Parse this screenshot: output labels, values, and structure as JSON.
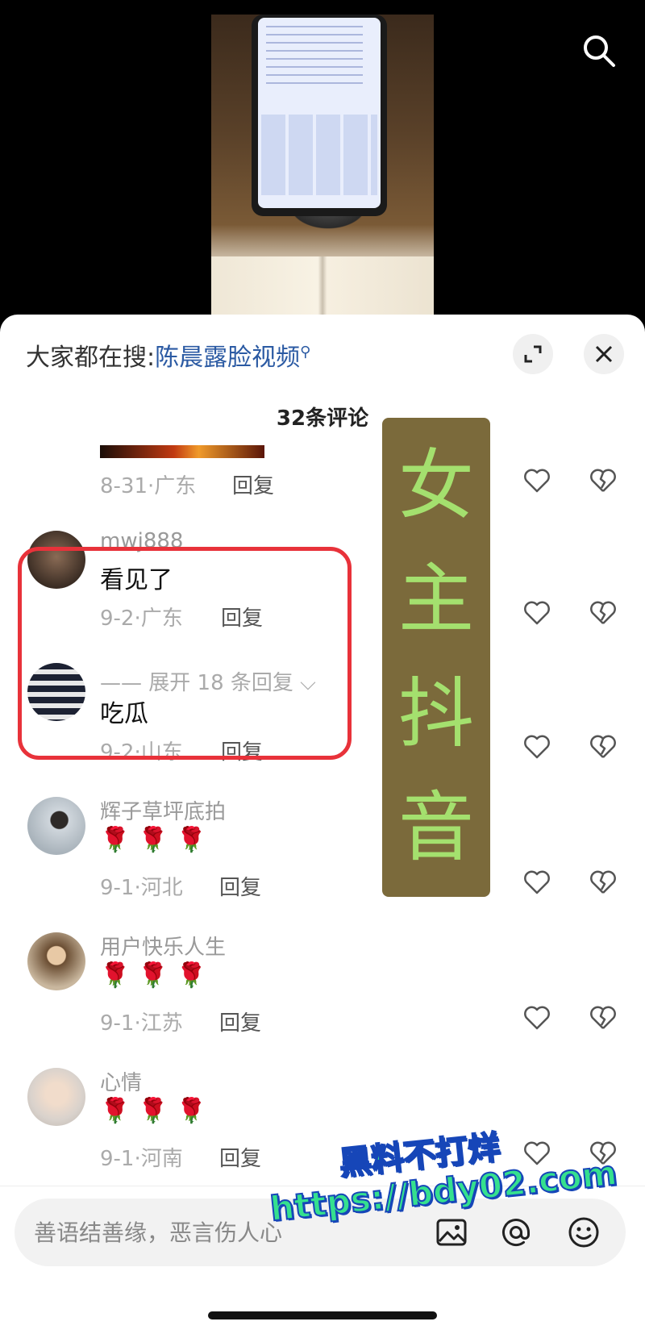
{
  "video": {
    "search_icon": "search-icon"
  },
  "panel": {
    "hot_search_prefix": "大家都在搜:",
    "hot_search_keyword": "陈晨露脸视频",
    "comment_count": "32条评论"
  },
  "comments": [
    {
      "meta": "8-31·广东",
      "reply": "回复"
    },
    {
      "username": "mwj888",
      "text": "看见了",
      "meta": "9-2·广东",
      "reply": "回复"
    },
    {
      "expand": "—— 展开 18 条回复",
      "text": "吃瓜",
      "meta": "9-2·山东",
      "reply": "回复"
    },
    {
      "username": "辉子草坪底拍",
      "meta": "9-1·河北",
      "reply": "回复"
    },
    {
      "username": "用户快乐人生",
      "meta": "9-1·江苏",
      "reply": "回复"
    },
    {
      "username": "心情",
      "meta": "9-1·河南",
      "reply": "回复"
    }
  ],
  "overlay": {
    "banner": [
      "女",
      "主",
      "抖",
      "音"
    ],
    "watermark_line1": "黑料不打烊",
    "watermark_line2": "https://bdy02.com"
  },
  "input": {
    "placeholder": "善语结善缘，恶言伤人心"
  },
  "colors": {
    "link_blue": "#2b5aa3",
    "annotation_red": "#e8323a",
    "banner_bg": "#7b6a3b",
    "banner_text": "#a4e06e"
  }
}
